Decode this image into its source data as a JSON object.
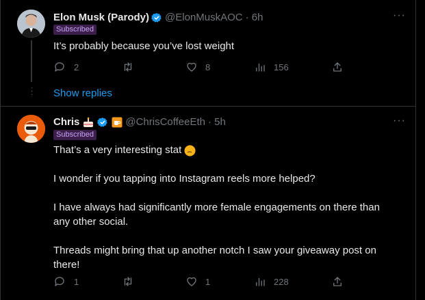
{
  "tweets": [
    {
      "name": "Elon Musk (Parody)",
      "handle": "@ElonMuskAOC",
      "time": "· 6h",
      "badge": "Subscribed",
      "text": [
        "It’s probably because you’ve lost weight"
      ],
      "replies": "2",
      "likes": "8",
      "views": "156"
    },
    {
      "name": "Chris",
      "handle": "@ChrisCoffeeEth",
      "time": "· 5h",
      "badge": "Subscribed",
      "text": [
        "That’s a very interesting stat",
        "I wonder if you tapping into Instagram reels  more helped?",
        "I have always had significantly more female engagements on there than any other social.",
        "Threads might bring that up another notch I saw your giveaway post on there!"
      ],
      "replies": "1",
      "likes": "1",
      "views": "228"
    }
  ],
  "show_replies": "Show replies",
  "colors": {
    "accent": "#1d9bf0",
    "verified": "#1d9bf0",
    "muted": "#71767b"
  },
  "icons": [
    "verified-badge-icon",
    "more-icon",
    "reply-icon",
    "retweet-icon",
    "like-icon",
    "views-icon",
    "share-icon",
    "cake-emoji-icon",
    "coffee-emoji-icon"
  ]
}
